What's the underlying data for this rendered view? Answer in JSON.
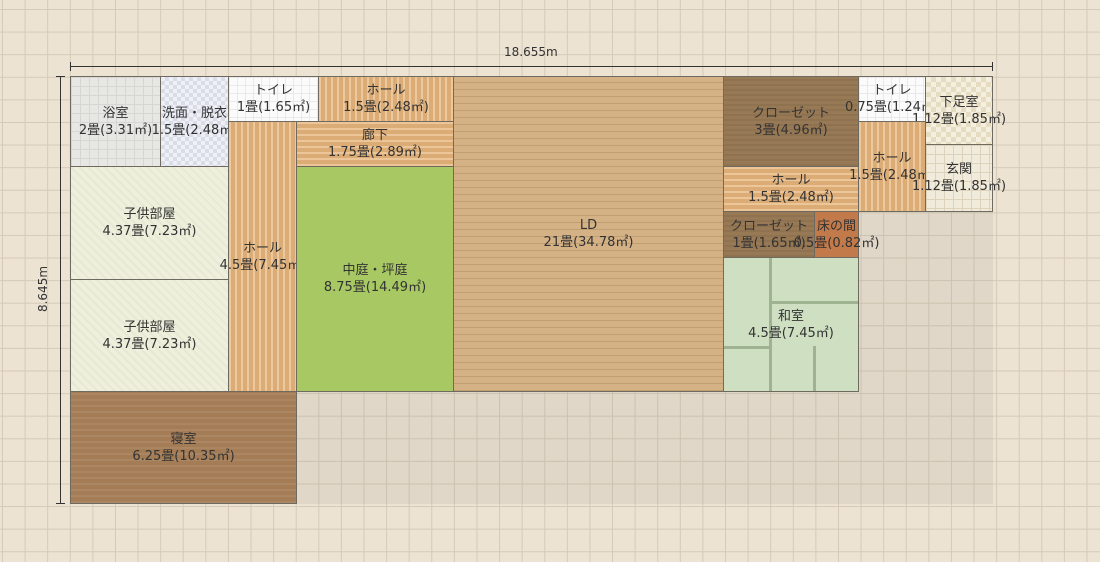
{
  "dimensions": {
    "width_label": "18.655m",
    "height_label": "8.645m"
  },
  "rooms": {
    "bath": {
      "name": "浴室",
      "area": "2畳(3.31㎡)"
    },
    "washroom": {
      "name": "洗面・脱衣",
      "area": "1.5畳(2.48㎡)"
    },
    "toilet1": {
      "name": "トイレ",
      "area": "1畳(1.65㎡)"
    },
    "hall_top": {
      "name": "ホール",
      "area": "1.5畳(2.48㎡)"
    },
    "corridor": {
      "name": "廊下",
      "area": "1.75畳(2.89㎡)"
    },
    "ld": {
      "name": "LD",
      "area": "21畳(34.78㎡)"
    },
    "closet1": {
      "name": "クローゼット",
      "area": "3畳(4.96㎡)"
    },
    "toilet2": {
      "name": "トイレ",
      "area": "0.75畳(1.24㎡)"
    },
    "shoe_room": {
      "name": "下足室",
      "area": "1.12畳(1.85㎡)"
    },
    "kids1": {
      "name": "子供部屋",
      "area": "4.37畳(7.23㎡)"
    },
    "hall_v": {
      "name": "ホール",
      "area": "4.5畳(7.45㎡)"
    },
    "courtyard": {
      "name": "中庭・坪庭",
      "area": "8.75畳(14.49㎡)"
    },
    "hall_mid": {
      "name": "ホール",
      "area": "1.5畳(2.48㎡)"
    },
    "hall_right": {
      "name": "ホール",
      "area": "1.5畳(2.48㎡)"
    },
    "entrance": {
      "name": "玄関",
      "area": "1.12畳(1.85㎡)"
    },
    "closet2": {
      "name": "クローゼット",
      "area": "1畳(1.65㎡)"
    },
    "tokonoma": {
      "name": "床の間",
      "area": "0.5畳(0.82㎡)"
    },
    "kids2": {
      "name": "子供部屋",
      "area": "4.37畳(7.23㎡)"
    },
    "washitsu": {
      "name": "和室",
      "area": "4.5畳(7.45㎡)"
    },
    "bedroom": {
      "name": "寝室",
      "area": "6.25畳(10.35㎡)"
    }
  }
}
